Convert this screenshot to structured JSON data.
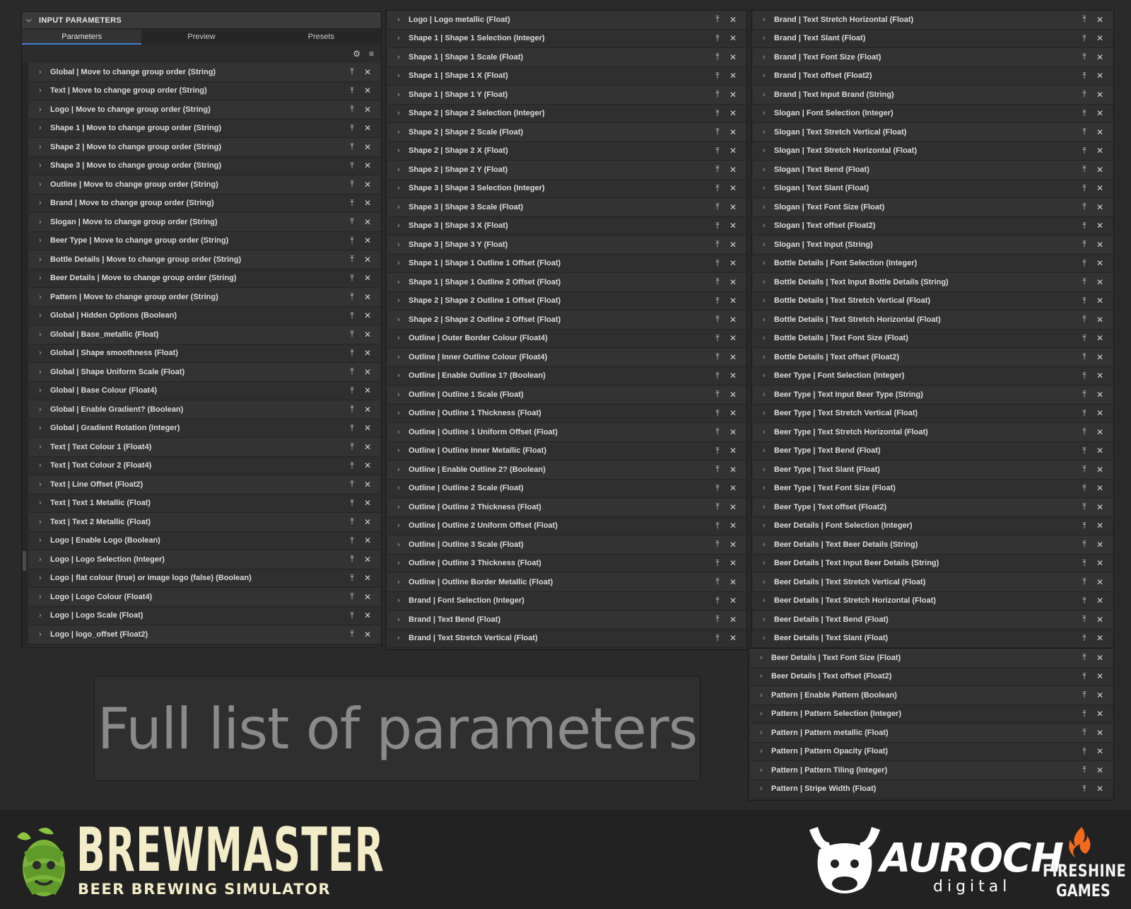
{
  "left_panel": {
    "title": "INPUT PARAMETERS",
    "tabs": [
      "Parameters",
      "Preview",
      "Presets"
    ],
    "items": [
      "Global | Move to change group order (String)",
      "Text | Move to change group order (String)",
      "Logo | Move to change group order (String)",
      "Shape 1 | Move to change group order (String)",
      "Shape 2 | Move to change group order (String)",
      "Shape 3 | Move to change group order (String)",
      "Outline | Move to change group order (String)",
      "Brand | Move to change group order (String)",
      "Slogan | Move to change group order (String)",
      "Beer Type | Move to change group order (String)",
      "Bottle Details | Move to change group order (String)",
      "Beer Details | Move to change group order (String)",
      "Pattern | Move to change group order (String)",
      "Global | Hidden Options (Boolean)",
      "Global | Base_metallic (Float)",
      "Global | Shape smoothness (Float)",
      "Global | Shape Uniform Scale (Float)",
      "Global | Base Colour (Float4)",
      "Global | Enable Gradient? (Boolean)",
      "Global | Gradient Rotation (Integer)",
      "Text | Text Colour 1 (Float4)",
      "Text | Text Colour 2 (Float4)",
      "Text | Line Offset (Float2)",
      "Text | Text 1 Metallic (Float)",
      "Text | Text 2 Metallic (Float)",
      "Logo | Enable Logo (Boolean)",
      "Logo | Logo Selection (Integer)",
      "Logo | flat colour (true) or image logo (false) (Boolean)",
      "Logo | Logo Colour (Float4)",
      "Logo | Logo Scale (Float)",
      "Logo | logo_offset (Float2)"
    ]
  },
  "middle_panel": {
    "items": [
      "Logo | Logo metallic (Float)",
      "Shape 1 | Shape 1 Selection (Integer)",
      "Shape 1 | Shape 1 Scale (Float)",
      "Shape 1 | Shape 1 X (Float)",
      "Shape 1 | Shape 1 Y (Float)",
      "Shape 2 | Shape 2 Selection (Integer)",
      "Shape 2 | Shape 2 Scale (Float)",
      "Shape 2 | Shape 2 X (Float)",
      "Shape 2 | Shape 2 Y (Float)",
      "Shape 3 | Shape 3 Selection (Integer)",
      "Shape 3 | Shape 3 Scale (Float)",
      "Shape 3 | Shape 3 X (Float)",
      "Shape 3 | Shape 3 Y (Float)",
      "Shape 1 | Shape 1 Outline 1 Offset (Float)",
      "Shape 1 | Shape 1 Outline 2 Offset (Float)",
      "Shape 2 | Shape 2 Outline 1 Offset (Float)",
      "Shape 2 | Shape 2 Outline 2 Offset (Float)",
      "Outline | Outer Border Colour (Float4)",
      "Outline | Inner Outline Colour (Float4)",
      "Outline | Enable Outline 1? (Boolean)",
      "Outline | Outline 1 Scale (Float)",
      "Outline | Outline 1 Thickness (Float)",
      "Outline | Outline 1 Uniform Offset (Float)",
      "Outline | Outline Inner Metallic (Float)",
      "Outline | Enable Outline 2? (Boolean)",
      "Outline | Outline 2 Scale (Float)",
      "Outline | Outline 2 Thickness (Float)",
      "Outline | Outline 2 Uniform Offset (Float)",
      "Outline | Outline 3 Scale (Float)",
      "Outline | Outline 3 Thickness (Float)",
      "Outline | Outline Border Metallic (Float)",
      "Brand | Font Selection (Integer)",
      "Brand | Text Bend (Float)",
      "Brand | Text Stretch Vertical (Float)"
    ]
  },
  "right_panel": {
    "items": [
      "Brand | Text Stretch Horizontal (Float)",
      "Brand | Text Slant (Float)",
      "Brand | Text Font Size (Float)",
      "Brand | Text offset (Float2)",
      "Brand | Text Input Brand (String)",
      "Slogan | Font Selection (Integer)",
      "Slogan | Text Stretch Vertical (Float)",
      "Slogan | Text Stretch Horizontal (Float)",
      "Slogan | Text Bend (Float)",
      "Slogan | Text Slant (Float)",
      "Slogan | Text Font Size (Float)",
      "Slogan | Text offset (Float2)",
      "Slogan | Text Input (String)",
      "Bottle Details | Font Selection (Integer)",
      "Bottle Details | Text Input Bottle Details (String)",
      "Bottle Details | Text Stretch Vertical (Float)",
      "Bottle Details | Text Stretch Horizontal (Float)",
      "Bottle Details | Text Font Size (Float)",
      "Bottle Details | Text offset (Float2)",
      "Beer Type | Font Selection (Integer)",
      "Beer Type | Text Input Beer Type (String)",
      "Beer Type | Text Stretch Vertical (Float)",
      "Beer Type | Text Stretch Horizontal (Float)",
      "Beer Type | Text Bend (Float)",
      "Beer Type | Text Slant (Float)",
      "Beer Type | Text Font Size (Float)",
      "Beer Type | Text offset (Float2)",
      "Beer Details | Font Selection (Integer)",
      "Beer Details | Text Beer Details (String)",
      "Beer Details | Text Input Beer Details (String)",
      "Beer Details | Text Stretch Vertical (Float)",
      "Beer Details | Text Stretch Horizontal (Float)",
      "Beer Details | Text Bend (Float)",
      "Beer Details | Text Slant (Float)"
    ]
  },
  "right_panel_2": {
    "items": [
      "Beer Details | Text Font Size (Float)",
      "Beer Details | Text offset (Float2)",
      "Pattern | Enable Pattern (Boolean)",
      "Pattern | Pattern Selection (Integer)",
      "Pattern | Pattern metallic (Float)",
      "Pattern | Pattern Opacity (Float)",
      "Pattern | Pattern Tiling (Integer)",
      "Pattern | Stripe Width (Float)"
    ]
  },
  "caption": "Full list of parameters",
  "footer": {
    "brewmaster_title": "BREWMASTER",
    "brewmaster_sub": "BEER BREWING SIMULATOR",
    "auroch_title": "AUROCH",
    "auroch_sub": "digital",
    "fireshine_line1": "FIRESHINE",
    "fireshine_line2": "GAMES"
  },
  "icons": {
    "expand": "chevron-right-icon",
    "publish": "upload-icon",
    "remove": "close-icon",
    "collapse": "chevron-down-icon",
    "settings": "gear-icon",
    "filter": "filter-icon"
  },
  "colors": {
    "background": "#2a2a2a",
    "row_bg": "#333333",
    "tab_active_underline": "#3d7fd1",
    "brewmaster_cream": "#f3ecc9",
    "fireshine_orange": "#f26a1b"
  }
}
